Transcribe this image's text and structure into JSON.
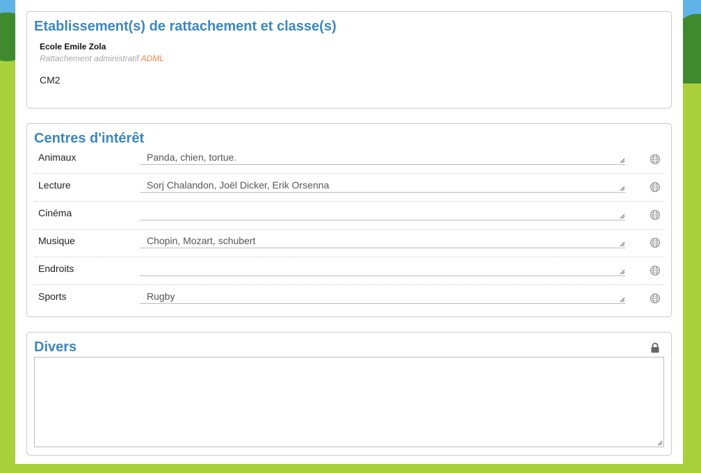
{
  "etablissement": {
    "title": "Etablissement(s) de rattachement et classe(s)",
    "school": "Ecole Emile Zola",
    "rattachement_label": "Rattachement administratif",
    "rattachement_value": "ADML",
    "class": "CM2"
  },
  "centres": {
    "title": "Centres d'intérêt",
    "rows": [
      {
        "label": "Animaux",
        "value": "Panda, chien, tortue."
      },
      {
        "label": "Lecture",
        "value": "Sorj Chalandon, Joël Dicker, Erik Orsenna"
      },
      {
        "label": "Cinéma",
        "value": ""
      },
      {
        "label": "Musique",
        "value": "Chopin, Mozart, schubert"
      },
      {
        "label": "Endroits",
        "value": ""
      },
      {
        "label": "Sports",
        "value": "Rugby"
      }
    ],
    "visibility_icon": "globe-icon"
  },
  "divers": {
    "title": "Divers",
    "visibility_icon": "lock-icon",
    "value": ""
  },
  "colors": {
    "heading": "#3b87c0",
    "accent": "#f0894b",
    "background_grass": "#a9cf3b"
  }
}
